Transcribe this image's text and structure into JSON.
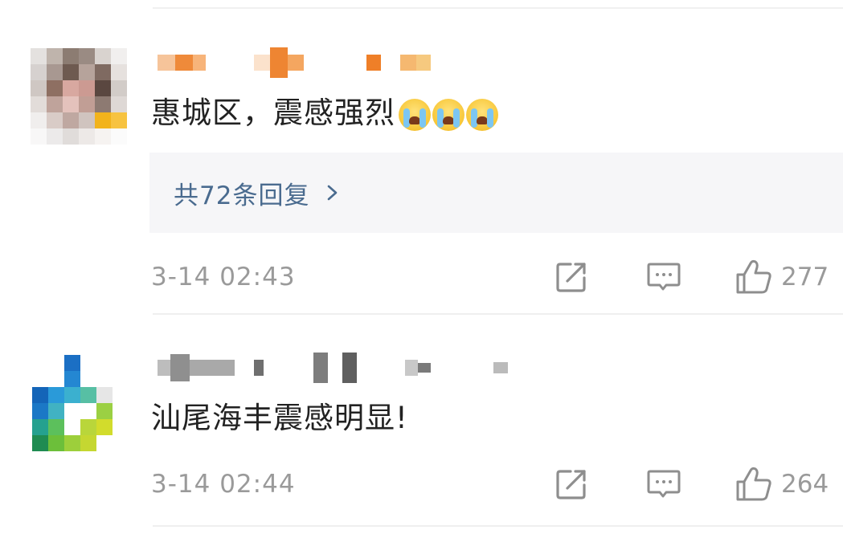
{
  "comments": [
    {
      "text": "惠城区，震感强烈",
      "emoji": [
        "loudly-crying-face-emoji",
        "loudly-crying-face-emoji",
        "loudly-crying-face-emoji"
      ],
      "replies_label": "共72条回复",
      "timestamp": "3-14 02:43",
      "likes": "277"
    },
    {
      "text": "汕尾海丰震感明显!",
      "emoji": [],
      "replies_label": null,
      "timestamp": "3-14 02:44",
      "likes": "264"
    }
  ],
  "icons": {
    "forward": "repost-icon",
    "comment": "comment-icon",
    "like": "thumbs-up-icon",
    "replies_arrow": "chevron-right-icon"
  },
  "colors": {
    "text": "#222222",
    "meta": "#9a9a9a",
    "link": "#4a6b8f",
    "reply_bg": "#f6f6f8"
  }
}
